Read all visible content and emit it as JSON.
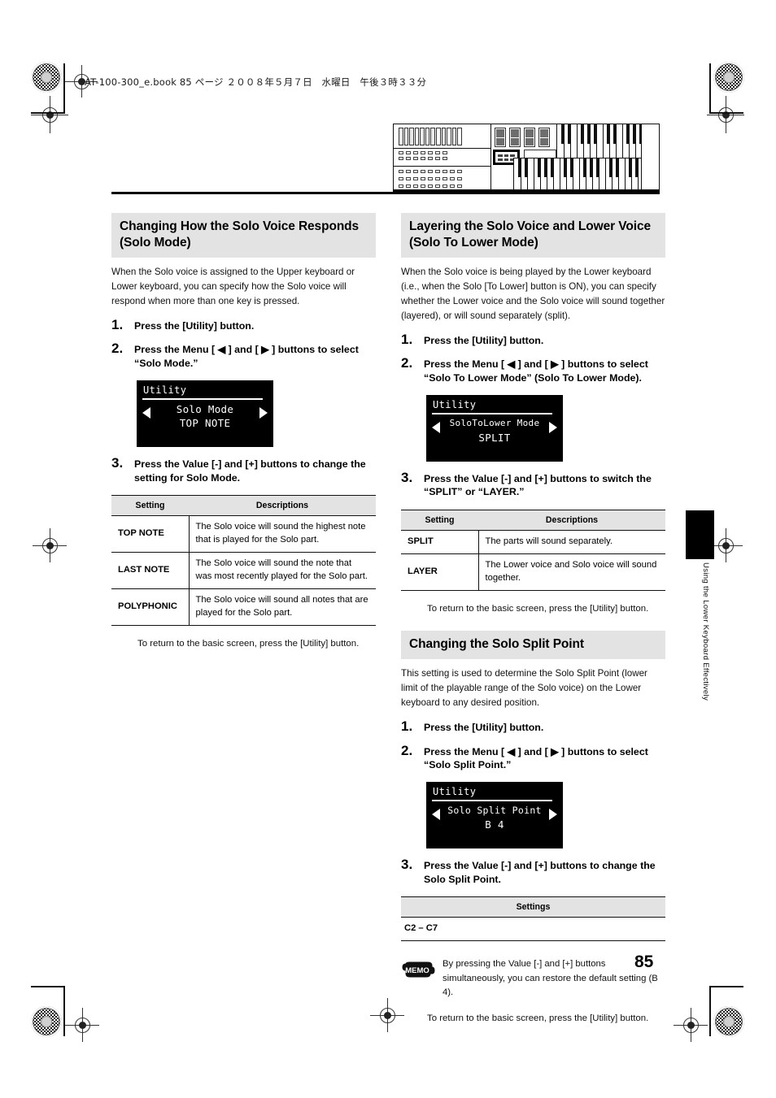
{
  "header": {
    "file_line": "AT-100-300_e.book  85 ページ  ２００８年５月７日　水曜日　午後３時３３分"
  },
  "figure": {
    "name": "organ-keyboard-panel-diagram",
    "highlight": "menu-buttons-highlighted"
  },
  "left_column": {
    "section": {
      "title": "Changing How the Solo Voice Responds (Solo Mode)",
      "intro": "When the Solo voice is assigned to the Upper keyboard or Lower keyboard, you can specify how the Solo voice will respond when more than one key is pressed.",
      "steps": [
        {
          "num": "1.",
          "text": "Press the [Utility] button."
        },
        {
          "num": "2.",
          "text": "Press the Menu [ ◀ ] and [ ▶ ] buttons to select “Solo Mode.”"
        },
        {
          "num": "3.",
          "text": "Press the Value [-] and [+] buttons to change the setting for Solo Mode."
        }
      ],
      "lcd": {
        "title": "Utility",
        "line1": "Solo Mode",
        "line2": "TOP NOTE",
        "left_arrow": "left-triangle-icon",
        "right_arrow": "right-triangle-icon"
      },
      "table": {
        "headers": [
          "Setting",
          "Descriptions"
        ],
        "rows": [
          {
            "setting": "TOP NOTE",
            "description": "The Solo voice will sound the highest note that is played for the Solo part."
          },
          {
            "setting": "LAST NOTE",
            "description": "The Solo voice will sound the note that was most recently played for the Solo part."
          },
          {
            "setting": "POLYPHONIC",
            "description": "The Solo voice will sound all notes that are played for the Solo part."
          }
        ]
      },
      "return_note": "To return to the basic screen, press the [Utility] button."
    }
  },
  "right_column": {
    "section_a": {
      "title": "Layering the Solo Voice and Lower Voice (Solo To Lower Mode)",
      "intro": "When the Solo voice is being played by the Lower keyboard (i.e., when the Solo [To Lower] button is ON), you can specify whether the Lower voice and the Solo voice will sound together (layered), or will sound separately (split).",
      "steps": [
        {
          "num": "1.",
          "text": "Press the [Utility] button."
        },
        {
          "num": "2.",
          "text": "Press the Menu [ ◀ ] and [ ▶ ] buttons to select “Solo To Lower Mode” (Solo To Lower Mode)."
        },
        {
          "num": "3.",
          "text": "Press the Value [-] and [+] buttons to switch the “SPLIT” or “LAYER.”"
        }
      ],
      "lcd": {
        "title": "Utility",
        "line1": "SoloToLower Mode",
        "line2": "SPLIT",
        "left_arrow": "left-triangle-icon",
        "right_arrow": "right-triangle-icon"
      },
      "table": {
        "headers": [
          "Setting",
          "Descriptions"
        ],
        "rows": [
          {
            "setting": "SPLIT",
            "description": "The parts will sound separately."
          },
          {
            "setting": "LAYER",
            "description": "The Lower voice and Solo voice will sound together."
          }
        ]
      },
      "return_note": "To return to the basic screen, press the [Utility] button."
    },
    "section_b": {
      "title": "Changing the Solo Split Point",
      "intro": "This setting is used to determine the Solo Split Point (lower limit of the playable range of the Solo voice) on the Lower keyboard to any desired position.",
      "steps": [
        {
          "num": "1.",
          "text": "Press the [Utility] button."
        },
        {
          "num": "2.",
          "text": "Press the Menu [ ◀ ] and [ ▶ ] buttons to select “Solo Split Point.”"
        },
        {
          "num": "3.",
          "text": "Press the Value [-] and [+] buttons to change the Solo Split Point."
        }
      ],
      "lcd": {
        "title": "Utility",
        "line1": "Solo Split Point",
        "line2": "B 4",
        "left_arrow": "left-triangle-icon",
        "right_arrow": "right-triangle-icon"
      },
      "table": {
        "headers": [
          "Settings"
        ],
        "rows": [
          {
            "value": "C2 – C7"
          }
        ]
      },
      "memo": {
        "icon_label": "MEMO",
        "text": "By pressing the Value [-] and [+] buttons simultaneously, you can restore the default setting (B 4)."
      },
      "return_note": "To return to the basic screen, press the [Utility] button."
    }
  },
  "side_tab": {
    "label": "Using the Lower Keyboard Effectively"
  },
  "page_number": "85"
}
